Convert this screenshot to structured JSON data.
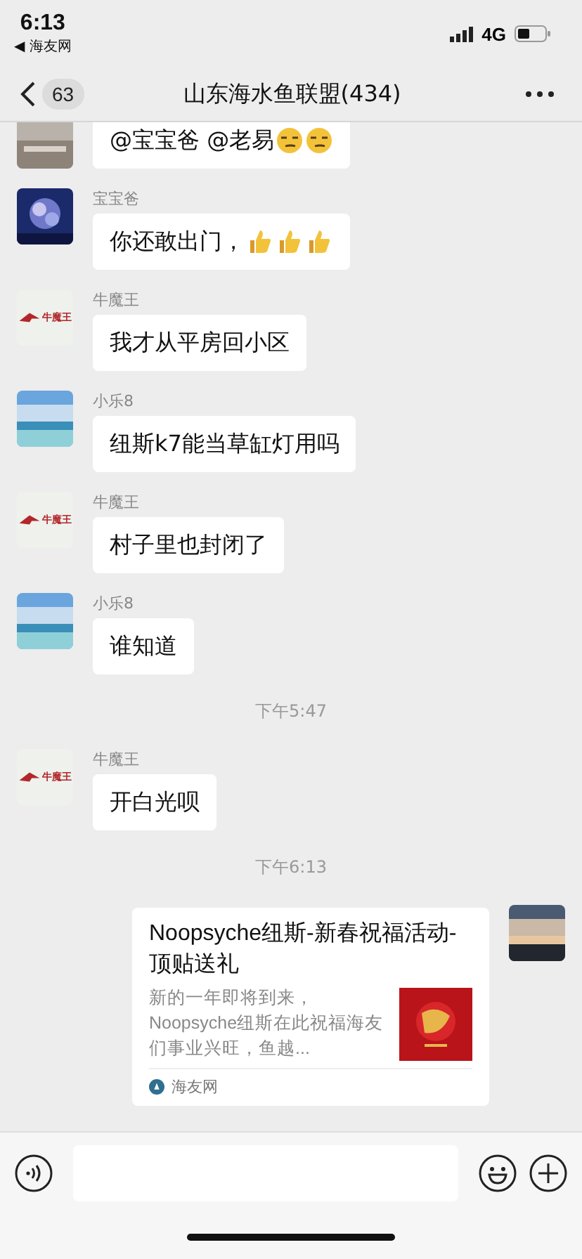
{
  "status_bar": {
    "time": "6:13",
    "back_app": "◀ 海友网",
    "network": "4G"
  },
  "header": {
    "unread": "63",
    "title": "山东海水鱼联盟(434)"
  },
  "messages": [
    {
      "kind": "text",
      "outgoing": false,
      "avatar": {
        "kind": "wall"
      },
      "text": "@宝宝爸 @老易",
      "emojis": [
        {
          "kind": "smirk"
        },
        {
          "kind": "smirk"
        }
      ]
    },
    {
      "kind": "text",
      "outgoing": false,
      "sender": "宝宝爸",
      "avatar": {
        "kind": "flower"
      },
      "text": "你还敢出门，",
      "emojis": [
        {
          "kind": "thumbs"
        },
        {
          "kind": "thumbs"
        },
        {
          "kind": "thumbs"
        }
      ]
    },
    {
      "kind": "text",
      "outgoing": false,
      "sender": "牛魔王",
      "avatar": {
        "kind": "logo",
        "text": "牛魔王"
      },
      "text": "我才从平房回小区"
    },
    {
      "kind": "text",
      "outgoing": false,
      "sender": "小乐8",
      "avatar": {
        "kind": "sea"
      },
      "text": "纽斯k7能当草缸灯用吗"
    },
    {
      "kind": "text",
      "outgoing": false,
      "sender": "牛魔王",
      "avatar": {
        "kind": "logo",
        "text": "牛魔王"
      },
      "text": "村子里也封闭了"
    },
    {
      "kind": "text",
      "outgoing": false,
      "sender": "小乐8",
      "avatar": {
        "kind": "sea"
      },
      "text": "谁知道"
    },
    {
      "kind": "time",
      "text": "下午5:47"
    },
    {
      "kind": "text",
      "outgoing": false,
      "sender": "牛魔王",
      "avatar": {
        "kind": "logo",
        "text": "牛魔王"
      },
      "text": "开白光呗"
    },
    {
      "kind": "time",
      "text": "下午6:13"
    },
    {
      "kind": "link",
      "outgoing": true,
      "avatar": {
        "kind": "sunset"
      },
      "title": "Noopsyche纽斯-新春祝福活动-顶贴送礼",
      "description": "新的一年即将到来，Noopsyche纽斯在此祝福海友们事业兴旺，鱼越...",
      "source": "海友网"
    }
  ]
}
